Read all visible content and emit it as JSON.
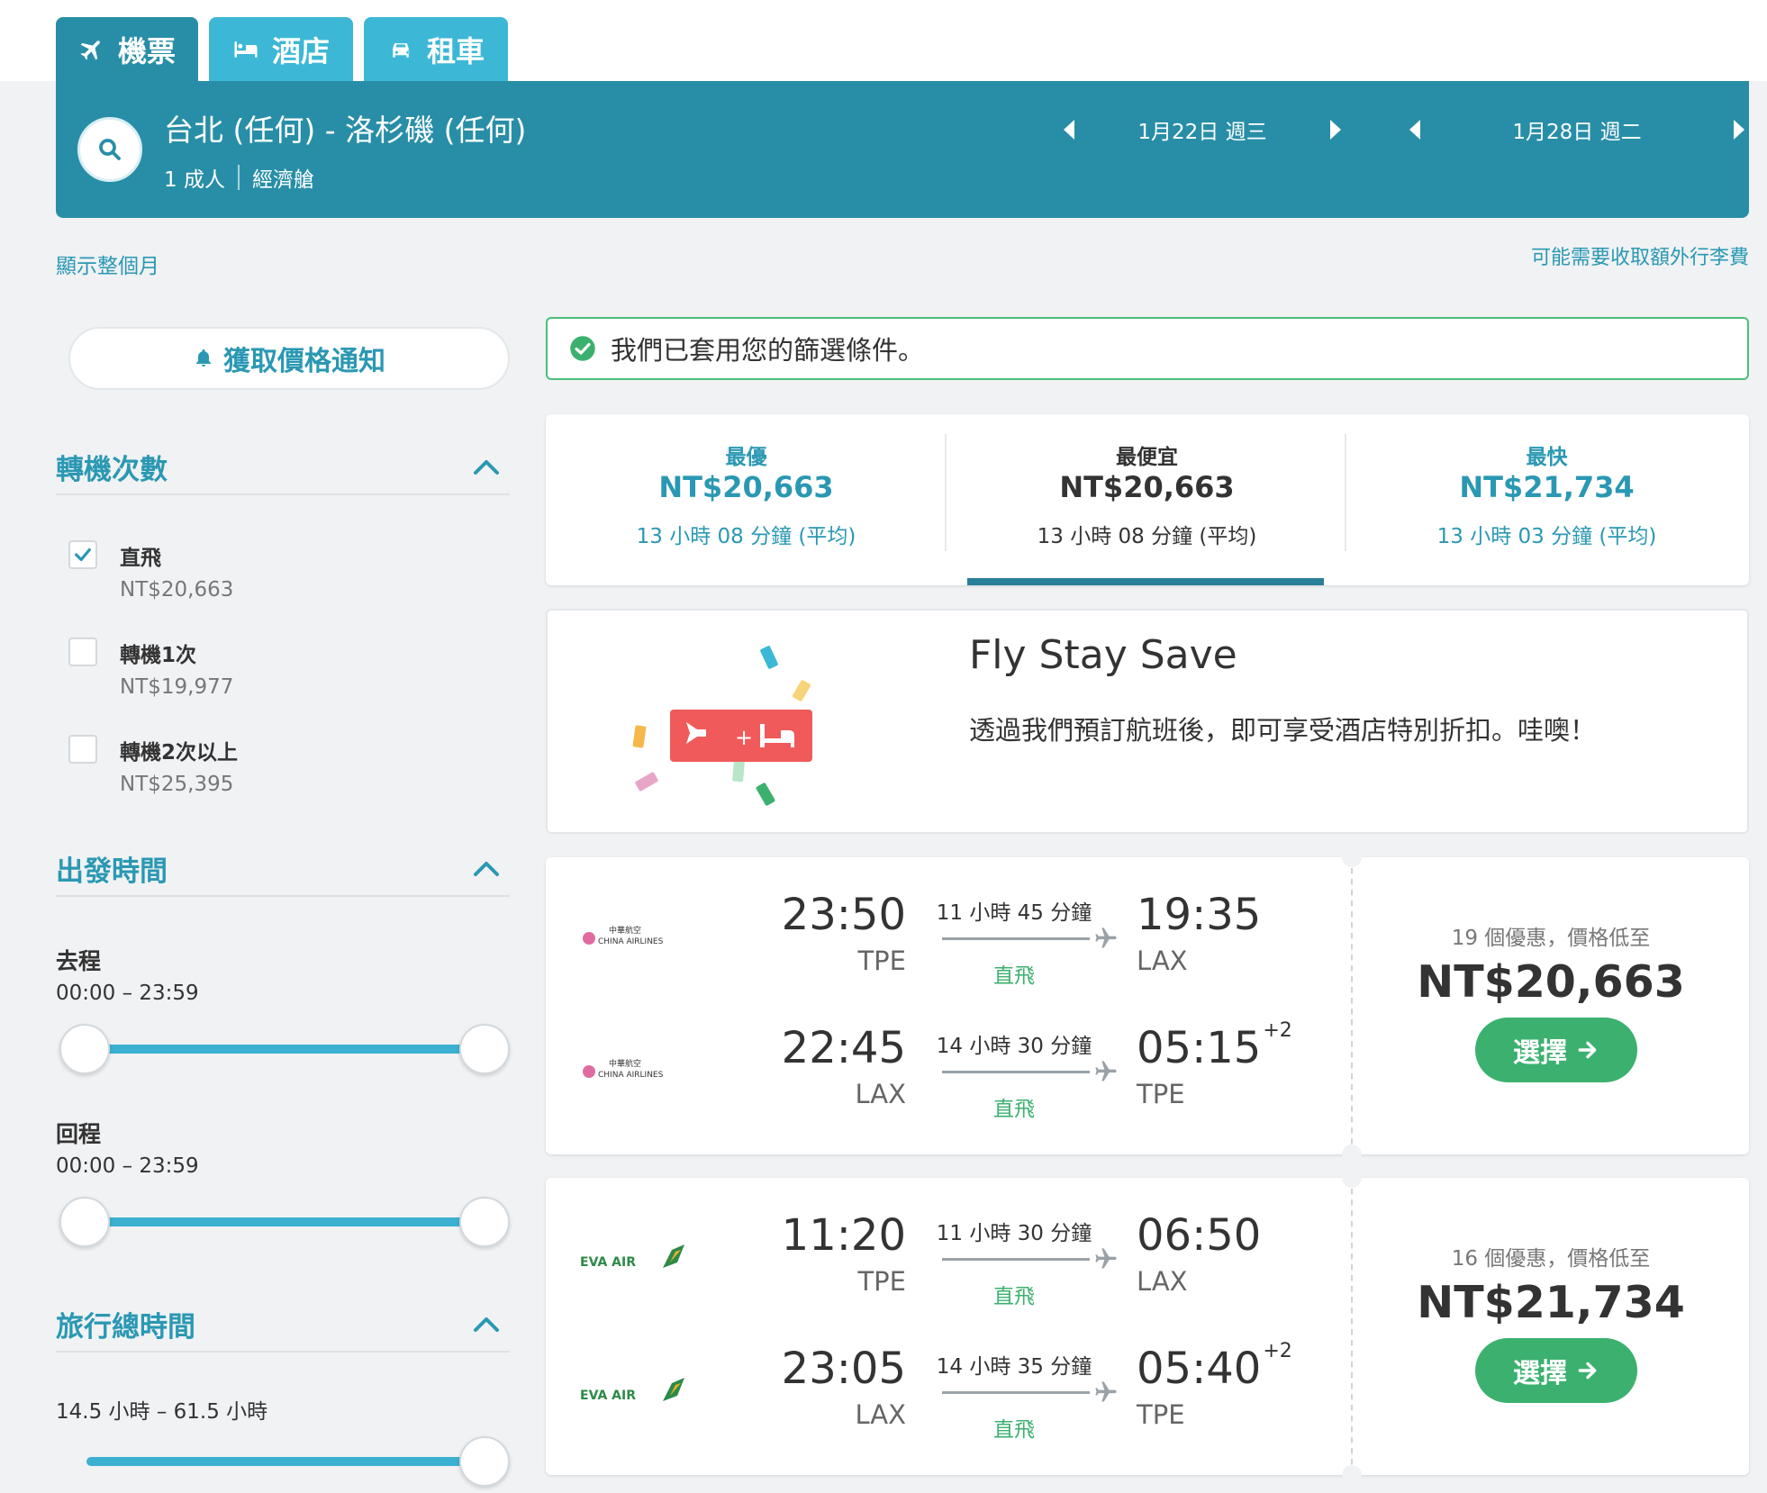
{
  "tabs": [
    {
      "label": "機票",
      "icon": "plane-icon",
      "active": true
    },
    {
      "label": "酒店",
      "icon": "bed-icon",
      "active": false
    },
    {
      "label": "租車",
      "icon": "car-icon",
      "active": false
    }
  ],
  "search": {
    "route": "台北 (任何) - 洛杉磯 (任何)",
    "passengers": "1 成人",
    "cabin": "經濟艙",
    "depart_date": "1月22日 週三",
    "return_date": "1月28日 週二"
  },
  "links": {
    "show_month": "顯示整個月",
    "baggage": "可能需要收取額外行李費"
  },
  "sidebar": {
    "alert_button": "獲取價格通知",
    "stops": {
      "title": "轉機次數",
      "options": [
        {
          "label": "直飛",
          "price": "NT$20,663",
          "checked": true
        },
        {
          "label": "轉機1次",
          "price": "NT$19,977",
          "checked": false
        },
        {
          "label": "轉機2次以上",
          "price": "NT$25,395",
          "checked": false
        }
      ]
    },
    "departure_time": {
      "title": "出發時間",
      "outbound_label": "去程",
      "outbound_range": "00:00 – 23:59",
      "outbound_slider": [
        0,
        1
      ],
      "return_label": "回程",
      "return_range": "00:00 – 23:59",
      "return_slider": [
        0,
        1
      ]
    },
    "duration": {
      "title": "旅行總時間",
      "range": "14.5 小時 – 61.5 小時",
      "slider_max": 1
    }
  },
  "filter_notice": "我們已套用您的篩選條件。",
  "sort": [
    {
      "label": "最優",
      "price": "NT$20,663",
      "duration": "13 小時 08 分鐘 (平均)",
      "selected": false
    },
    {
      "label": "最便宜",
      "price": "NT$20,663",
      "duration": "13 小時 08 分鐘 (平均)",
      "selected": true
    },
    {
      "label": "最快",
      "price": "NT$21,734",
      "duration": "13 小時 03 分鐘 (平均)",
      "selected": false
    }
  ],
  "promo": {
    "title": "Fly Stay Save",
    "text": "透過我們預訂航班後，即可享受酒店特別折扣。哇噢！"
  },
  "results": [
    {
      "airline": "CHINA AIRLINES",
      "airline_cn": "中華航空",
      "legs": [
        {
          "dep_time": "23:50",
          "dep_code": "TPE",
          "duration": "11 小時 45 分鐘",
          "stops": "直飛",
          "arr_time": "19:35",
          "arr_code": "LAX",
          "day_offset": ""
        },
        {
          "dep_time": "22:45",
          "dep_code": "LAX",
          "duration": "14 小時 30 分鐘",
          "stops": "直飛",
          "arr_time": "05:15",
          "arr_code": "TPE",
          "day_offset": "+2"
        }
      ],
      "offers": "19 個優惠，價格低至",
      "price": "NT$20,663",
      "select_label": "選擇"
    },
    {
      "airline": "EVA AIR",
      "legs": [
        {
          "dep_time": "11:20",
          "dep_code": "TPE",
          "duration": "11 小時 30 分鐘",
          "stops": "直飛",
          "arr_time": "06:50",
          "arr_code": "LAX",
          "day_offset": ""
        },
        {
          "dep_time": "23:05",
          "dep_code": "LAX",
          "duration": "14 小時 35 分鐘",
          "stops": "直飛",
          "arr_time": "05:40",
          "arr_code": "TPE",
          "day_offset": "+2"
        }
      ],
      "offers": "16 個優惠，價格低至",
      "price": "NT$21,734",
      "select_label": "選擇"
    }
  ],
  "colors": {
    "brand": "#288ea7",
    "tab": "#3cb8d6",
    "accent_blue": "#2a98b3",
    "success": "#3cb16f",
    "promo_red": "#f05a5a"
  }
}
